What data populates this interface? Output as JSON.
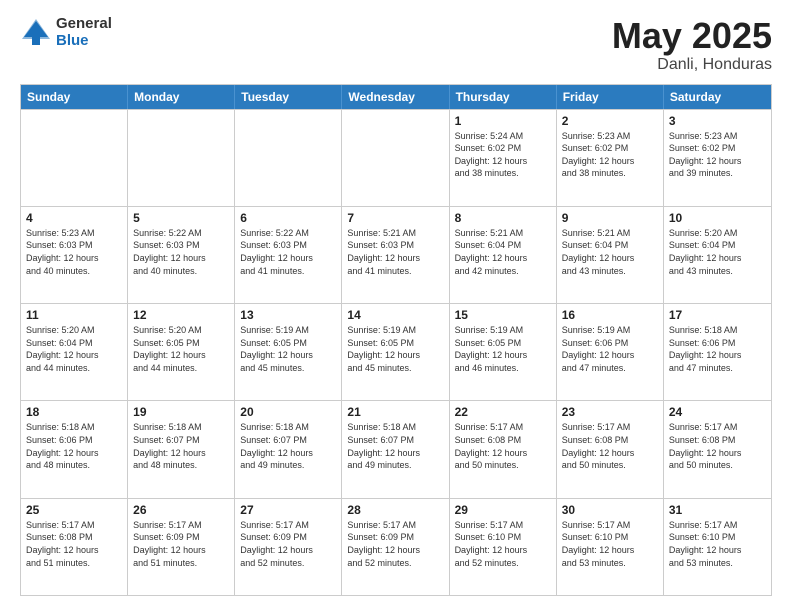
{
  "logo": {
    "general": "General",
    "blue": "Blue"
  },
  "title": {
    "month": "May 2025",
    "location": "Danli, Honduras"
  },
  "header_days": [
    "Sunday",
    "Monday",
    "Tuesday",
    "Wednesday",
    "Thursday",
    "Friday",
    "Saturday"
  ],
  "weeks": [
    [
      {
        "day": "",
        "info": ""
      },
      {
        "day": "",
        "info": ""
      },
      {
        "day": "",
        "info": ""
      },
      {
        "day": "",
        "info": ""
      },
      {
        "day": "1",
        "info": "Sunrise: 5:24 AM\nSunset: 6:02 PM\nDaylight: 12 hours\nand 38 minutes."
      },
      {
        "day": "2",
        "info": "Sunrise: 5:23 AM\nSunset: 6:02 PM\nDaylight: 12 hours\nand 38 minutes."
      },
      {
        "day": "3",
        "info": "Sunrise: 5:23 AM\nSunset: 6:02 PM\nDaylight: 12 hours\nand 39 minutes."
      }
    ],
    [
      {
        "day": "4",
        "info": "Sunrise: 5:23 AM\nSunset: 6:03 PM\nDaylight: 12 hours\nand 40 minutes."
      },
      {
        "day": "5",
        "info": "Sunrise: 5:22 AM\nSunset: 6:03 PM\nDaylight: 12 hours\nand 40 minutes."
      },
      {
        "day": "6",
        "info": "Sunrise: 5:22 AM\nSunset: 6:03 PM\nDaylight: 12 hours\nand 41 minutes."
      },
      {
        "day": "7",
        "info": "Sunrise: 5:21 AM\nSunset: 6:03 PM\nDaylight: 12 hours\nand 41 minutes."
      },
      {
        "day": "8",
        "info": "Sunrise: 5:21 AM\nSunset: 6:04 PM\nDaylight: 12 hours\nand 42 minutes."
      },
      {
        "day": "9",
        "info": "Sunrise: 5:21 AM\nSunset: 6:04 PM\nDaylight: 12 hours\nand 43 minutes."
      },
      {
        "day": "10",
        "info": "Sunrise: 5:20 AM\nSunset: 6:04 PM\nDaylight: 12 hours\nand 43 minutes."
      }
    ],
    [
      {
        "day": "11",
        "info": "Sunrise: 5:20 AM\nSunset: 6:04 PM\nDaylight: 12 hours\nand 44 minutes."
      },
      {
        "day": "12",
        "info": "Sunrise: 5:20 AM\nSunset: 6:05 PM\nDaylight: 12 hours\nand 44 minutes."
      },
      {
        "day": "13",
        "info": "Sunrise: 5:19 AM\nSunset: 6:05 PM\nDaylight: 12 hours\nand 45 minutes."
      },
      {
        "day": "14",
        "info": "Sunrise: 5:19 AM\nSunset: 6:05 PM\nDaylight: 12 hours\nand 45 minutes."
      },
      {
        "day": "15",
        "info": "Sunrise: 5:19 AM\nSunset: 6:05 PM\nDaylight: 12 hours\nand 46 minutes."
      },
      {
        "day": "16",
        "info": "Sunrise: 5:19 AM\nSunset: 6:06 PM\nDaylight: 12 hours\nand 47 minutes."
      },
      {
        "day": "17",
        "info": "Sunrise: 5:18 AM\nSunset: 6:06 PM\nDaylight: 12 hours\nand 47 minutes."
      }
    ],
    [
      {
        "day": "18",
        "info": "Sunrise: 5:18 AM\nSunset: 6:06 PM\nDaylight: 12 hours\nand 48 minutes."
      },
      {
        "day": "19",
        "info": "Sunrise: 5:18 AM\nSunset: 6:07 PM\nDaylight: 12 hours\nand 48 minutes."
      },
      {
        "day": "20",
        "info": "Sunrise: 5:18 AM\nSunset: 6:07 PM\nDaylight: 12 hours\nand 49 minutes."
      },
      {
        "day": "21",
        "info": "Sunrise: 5:18 AM\nSunset: 6:07 PM\nDaylight: 12 hours\nand 49 minutes."
      },
      {
        "day": "22",
        "info": "Sunrise: 5:17 AM\nSunset: 6:08 PM\nDaylight: 12 hours\nand 50 minutes."
      },
      {
        "day": "23",
        "info": "Sunrise: 5:17 AM\nSunset: 6:08 PM\nDaylight: 12 hours\nand 50 minutes."
      },
      {
        "day": "24",
        "info": "Sunrise: 5:17 AM\nSunset: 6:08 PM\nDaylight: 12 hours\nand 50 minutes."
      }
    ],
    [
      {
        "day": "25",
        "info": "Sunrise: 5:17 AM\nSunset: 6:08 PM\nDaylight: 12 hours\nand 51 minutes."
      },
      {
        "day": "26",
        "info": "Sunrise: 5:17 AM\nSunset: 6:09 PM\nDaylight: 12 hours\nand 51 minutes."
      },
      {
        "day": "27",
        "info": "Sunrise: 5:17 AM\nSunset: 6:09 PM\nDaylight: 12 hours\nand 52 minutes."
      },
      {
        "day": "28",
        "info": "Sunrise: 5:17 AM\nSunset: 6:09 PM\nDaylight: 12 hours\nand 52 minutes."
      },
      {
        "day": "29",
        "info": "Sunrise: 5:17 AM\nSunset: 6:10 PM\nDaylight: 12 hours\nand 52 minutes."
      },
      {
        "day": "30",
        "info": "Sunrise: 5:17 AM\nSunset: 6:10 PM\nDaylight: 12 hours\nand 53 minutes."
      },
      {
        "day": "31",
        "info": "Sunrise: 5:17 AM\nSunset: 6:10 PM\nDaylight: 12 hours\nand 53 minutes."
      }
    ]
  ]
}
